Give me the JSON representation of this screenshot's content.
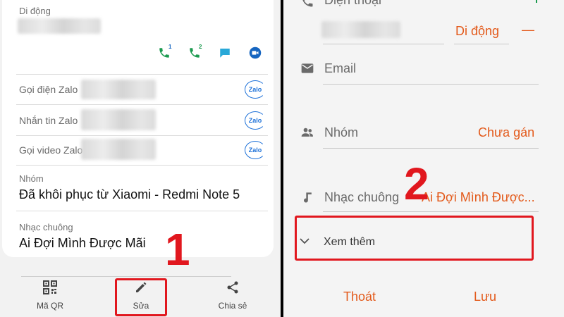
{
  "left": {
    "mobile_label": "Di động",
    "zalo_rows": [
      {
        "label": "Gọi điện Zalo"
      },
      {
        "label": "Nhắn tin Zalo"
      },
      {
        "label": "Gọi video Zalo"
      }
    ],
    "zalo_logo_text": "Zalo",
    "call_badges": [
      "1",
      "2"
    ],
    "group_label": "Nhóm",
    "group_value": "Đã khôi phục từ Xiaomi - Redmi Note 5",
    "ringtone_label": "Nhạc chuông",
    "ringtone_value": "Ai Đợi Mình Được Mãi",
    "nav": {
      "qr_label": "Mã QR",
      "edit_label": "Sửa",
      "share_label": "Chia sẻ"
    },
    "step_number": "1"
  },
  "right": {
    "phone_label": "Điện thoại",
    "phone_type": "Di động",
    "remove_symbol": "—",
    "email_label": "Email",
    "group_label": "Nhóm",
    "group_value": "Chưa gán",
    "ringtone_label": "Nhạc chuông",
    "ringtone_value": "Ai Đợi Mình Được...",
    "more_label": "Xem thêm",
    "cancel_label": "Thoát",
    "save_label": "Lưu",
    "step_number": "2"
  },
  "colors": {
    "accent_orange": "#e35a1b",
    "annotation_red": "#e1171e",
    "call_green": "#1b9a4f",
    "message_teal": "#29a8d8",
    "video_blue": "#1565c0",
    "zalo_blue": "#1a6fd8"
  }
}
